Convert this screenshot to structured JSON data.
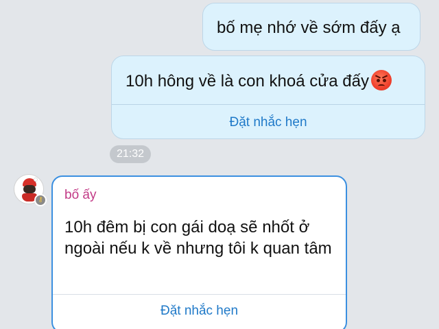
{
  "messages": [
    {
      "direction": "outgoing",
      "text": "bố mẹ nhớ về sớm đấy ạ"
    },
    {
      "direction": "outgoing",
      "text": "10h hông về là con khoá cửa đấy",
      "emoji": "angry-face-icon",
      "action_label": "Đặt nhắc hẹn"
    },
    {
      "direction": "incoming",
      "sender": "bố ấy",
      "text": "10h đêm bị con gái doạ sẽ nhốt ở ngoài nếu k về nhưng tôi k quan tâm",
      "action_label": "Đặt nhắc hẹn"
    }
  ],
  "timestamp": "21:32",
  "colors": {
    "outgoing_bubble": "#dcf2fd",
    "incoming_border": "#3a8fe0",
    "action_link": "#1f79c8",
    "sender_name": "#c23a86",
    "background": "#e3e6ea"
  }
}
